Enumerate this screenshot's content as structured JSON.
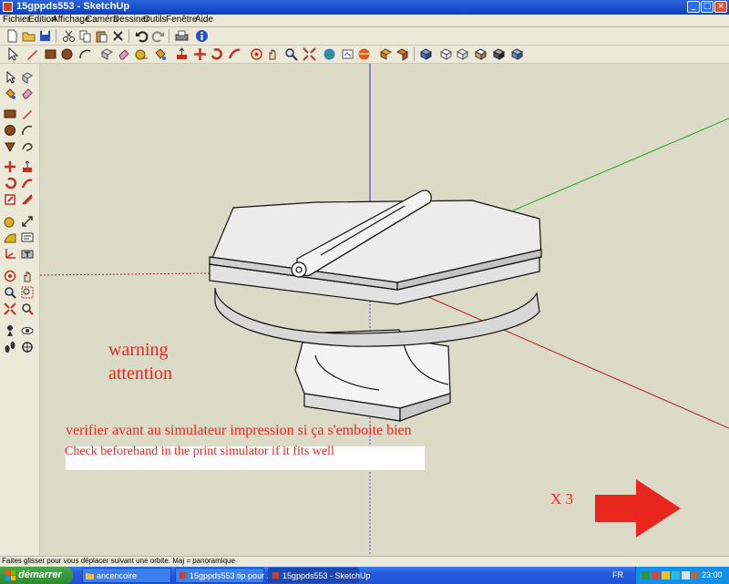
{
  "window": {
    "title": "15gppds553 - SketchUp"
  },
  "menu": [
    "Fichier",
    "Édition",
    "Affichage",
    "Caméra",
    "Dessiner",
    "Outils",
    "Fenêtre",
    "Aide"
  ],
  "viewport": {
    "warning_line1": "warning",
    "warning_line2": "attention",
    "note_fr": "verifier avant au simulateur impression si ça s'emboite bien",
    "note_en": "Check beforehand in the print simulator if it fits well",
    "multiplier": "X 3"
  },
  "status": {
    "text": "Faites glisser pour vous déplacer suivant une orbite.  Maj = panoramique"
  },
  "taskbar": {
    "start_label": "démarrer",
    "tasks": [
      "ancencoire",
      "15gppds553 tip pour ...",
      "15gppds553 - SketchUp"
    ],
    "lang": "FR",
    "clock": "23:00"
  },
  "colors": {
    "accent_red": "#e8261e",
    "axis_blue": "#2b2bd8",
    "axis_green": "#2aa02a",
    "axis_red": "#b02020",
    "viewport_bg": "#dcdbc7"
  }
}
